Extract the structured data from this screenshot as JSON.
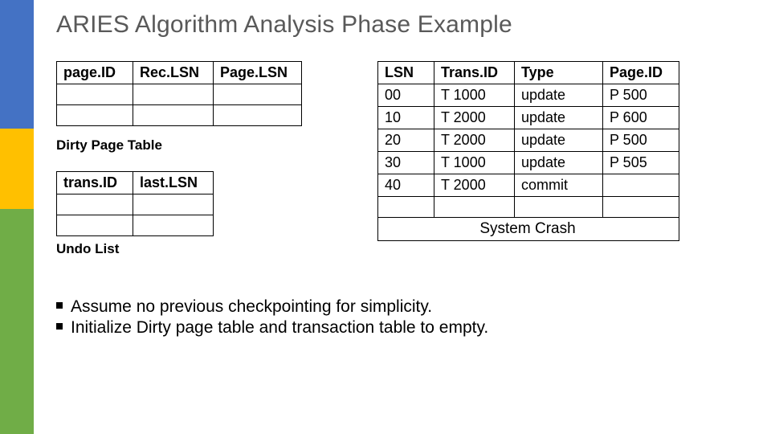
{
  "title": "ARIES Algorithm Analysis Phase Example",
  "dirty_page_table": {
    "headers": [
      "page.ID",
      "Rec.LSN",
      "Page.LSN"
    ],
    "rows": [
      [
        "",
        "",
        ""
      ],
      [
        "",
        "",
        ""
      ]
    ],
    "caption": "Dirty Page Table"
  },
  "undo_list": {
    "headers": [
      "trans.ID",
      "last.LSN"
    ],
    "rows": [
      [
        "",
        ""
      ],
      [
        "",
        ""
      ]
    ],
    "caption": "Undo List"
  },
  "log_table": {
    "headers": [
      "LSN",
      "Trans.ID",
      "Type",
      "Page.ID"
    ],
    "rows": [
      [
        "00",
        "T 1000",
        "update",
        "P 500"
      ],
      [
        "10",
        "T 2000",
        "update",
        "P 600"
      ],
      [
        "20",
        "T 2000",
        "update",
        "P 500"
      ],
      [
        "30",
        "T 1000",
        "update",
        "P 505"
      ],
      [
        "40",
        "T 2000",
        "commit",
        ""
      ]
    ],
    "empty_row": [
      "",
      "",
      "",
      ""
    ],
    "crash_label": "System Crash"
  },
  "bullets": [
    "Assume no previous checkpointing for simplicity.",
    "Initialize Dirty page table and transaction table to empty."
  ]
}
